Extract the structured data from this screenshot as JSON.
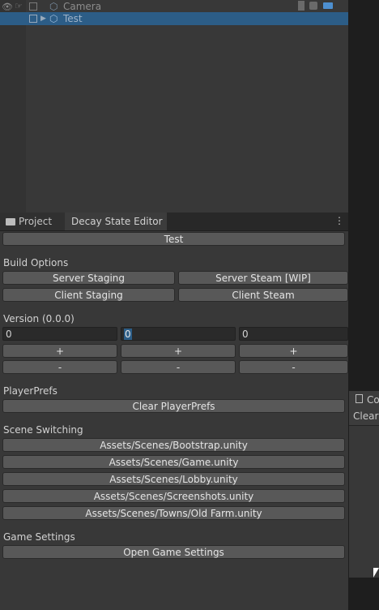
{
  "hierarchy": {
    "rows": [
      {
        "label": "Camera"
      },
      {
        "label": "Test"
      }
    ]
  },
  "tabs": {
    "project": "Project",
    "decay": "Decay State Editor"
  },
  "editor": {
    "test_button": "Test",
    "build_options": {
      "heading": "Build Options",
      "server_staging": "Server Staging",
      "server_steam": "Server Steam [WIP]",
      "client_staging": "Client Staging",
      "client_steam": "Client Steam"
    },
    "version": {
      "heading": "Version (0.0.0)",
      "fields": [
        "0",
        "0",
        "0"
      ],
      "plus": "+",
      "minus": "-"
    },
    "playerprefs": {
      "heading": "PlayerPrefs",
      "clear": "Clear PlayerPrefs"
    },
    "scene_switching": {
      "heading": "Scene Switching",
      "scenes": [
        "Assets/Scenes/Bootstrap.unity",
        "Assets/Scenes/Game.unity",
        "Assets/Scenes/Lobby.unity",
        "Assets/Scenes/Screenshots.unity",
        "Assets/Scenes/Towns/Old Farm.unity"
      ]
    },
    "game_settings": {
      "heading": "Game Settings",
      "open": "Open Game Settings"
    }
  },
  "console": {
    "tab": "Co",
    "clear": "Clear"
  },
  "colors": {
    "selection": "#2c5d87",
    "panel": "#383838",
    "button": "#585858"
  }
}
